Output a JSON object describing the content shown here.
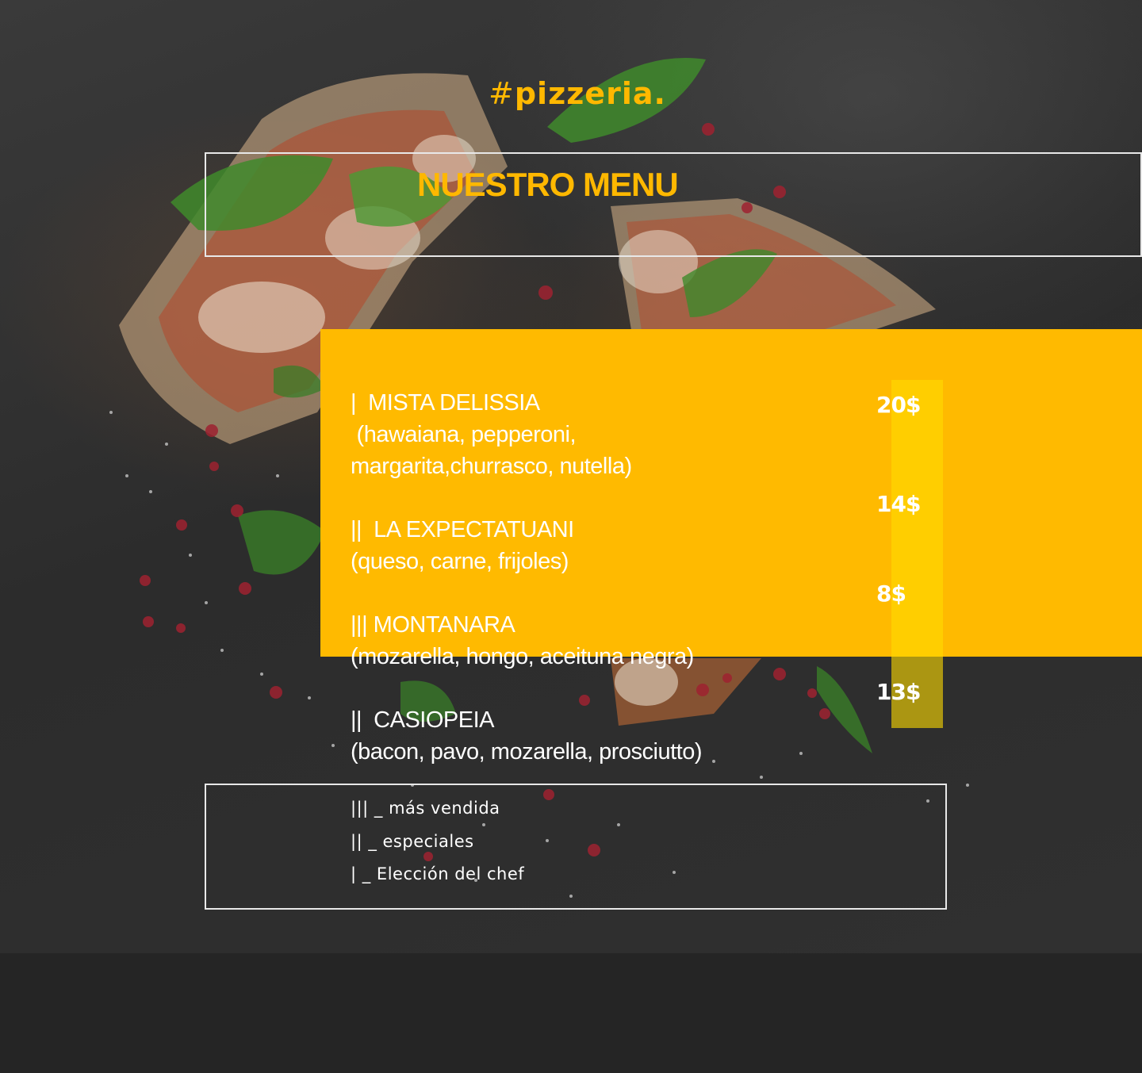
{
  "brand": {
    "hash": "#",
    "name": "pizzeria."
  },
  "menu_title": "NUESTRO MENU",
  "items": [
    {
      "name": "|  MISTA DELISSIA",
      "desc": " (hawaiana, pepperoni,",
      "desc2": "margarita,churrasco, nutella)",
      "price": "20$"
    },
    {
      "name": "||  LA EXPECTATUANI",
      "desc": "(queso, carne, frijoles)",
      "price": "14$"
    },
    {
      "name": "||| MONTANARA",
      "desc": "(mozarella, hongo, aceituna negra)",
      "price": "8$"
    },
    {
      "name": "||  CASIOPEIA",
      "desc": "(bacon, pavo, mozarella, prosciutto)",
      "price": "13$"
    }
  ],
  "legend": [
    "||| _ más vendida",
    "|| _ especiales",
    "| _ Elección del chef"
  ],
  "colors": {
    "accent": "#ffb800",
    "panel": "#ffba00",
    "background": "#2c2c2c"
  }
}
